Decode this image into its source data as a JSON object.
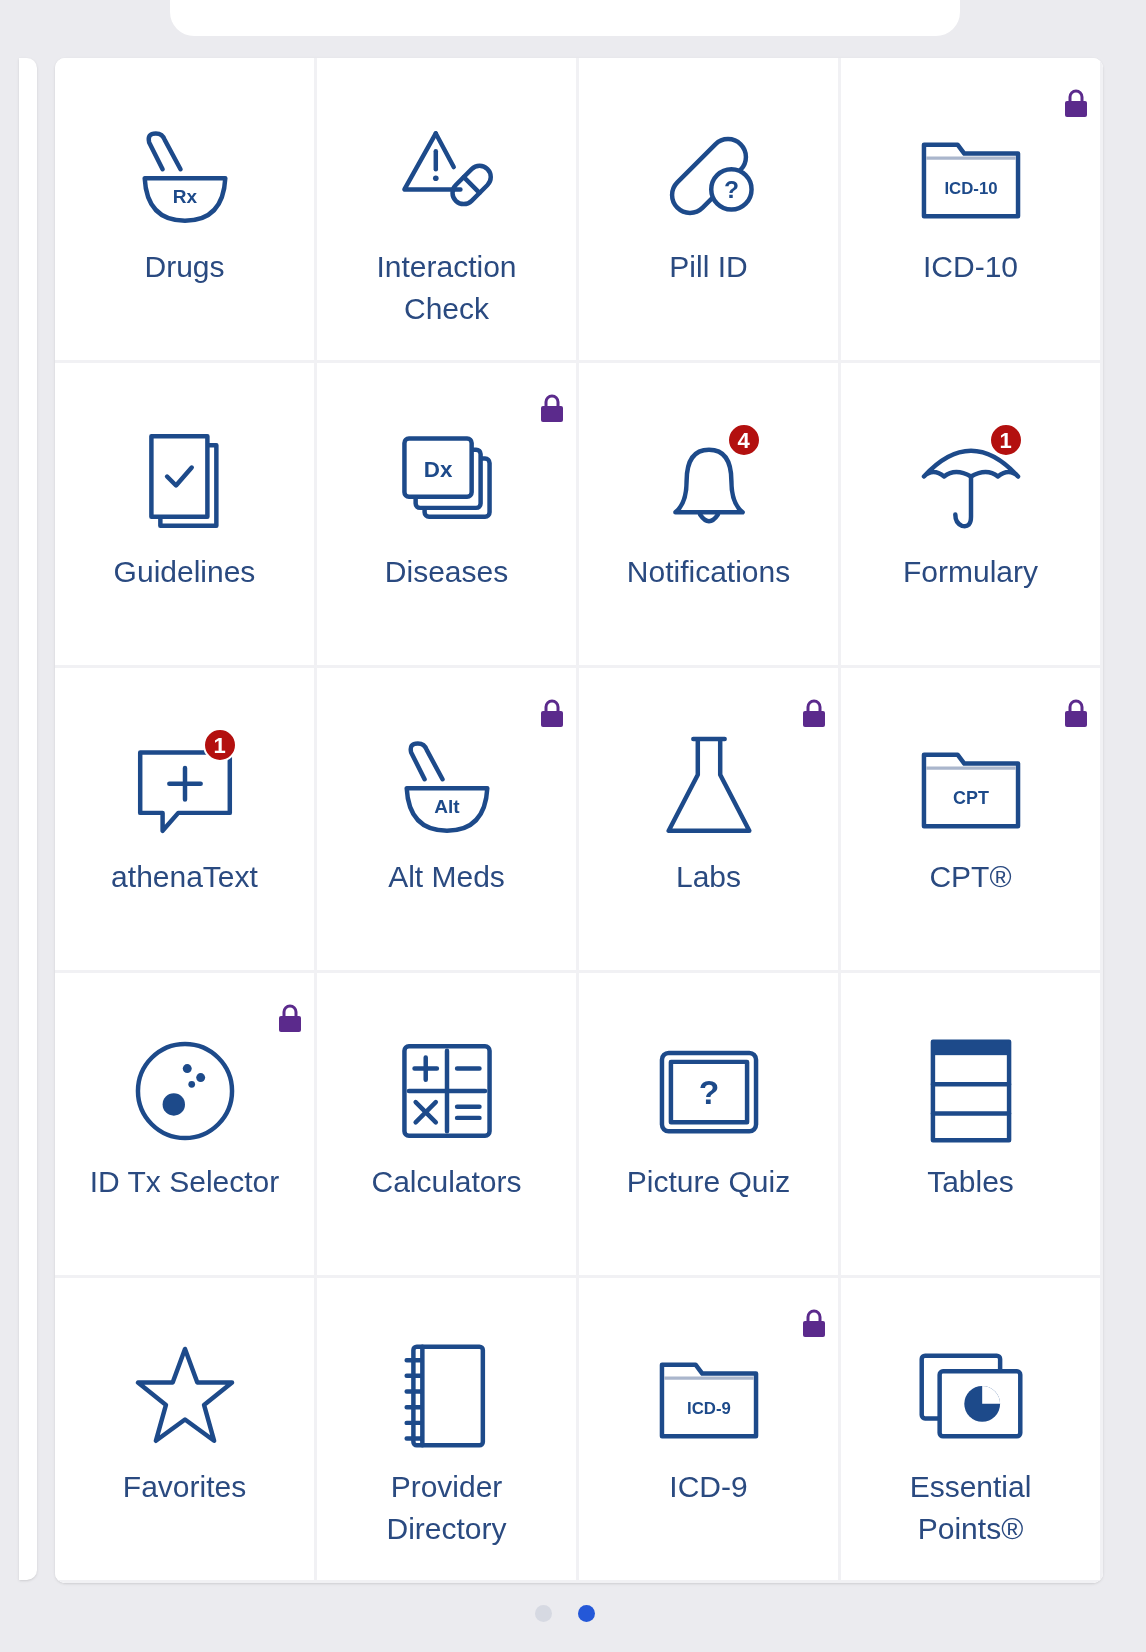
{
  "tiles": [
    {
      "kind": "drugs",
      "icon_text": "Rx",
      "label": "Drugs",
      "locked": false
    },
    {
      "kind": "interaction",
      "label": "Interaction Check",
      "locked": false
    },
    {
      "kind": "pill",
      "icon_text": "?",
      "label": "Pill ID",
      "locked": false
    },
    {
      "kind": "folder",
      "icon_text": "ICD-10",
      "label": "ICD-10",
      "locked": true
    },
    {
      "kind": "guidelines",
      "label": "Guidelines",
      "locked": false
    },
    {
      "kind": "stack",
      "icon_text": "Dx",
      "label": "Diseases",
      "locked": true
    },
    {
      "kind": "bell",
      "label": "Notifications",
      "locked": false,
      "badge": "4"
    },
    {
      "kind": "umbrella",
      "label": "Formulary",
      "locked": false,
      "badge": "1"
    },
    {
      "kind": "chat",
      "label": "athenaText",
      "locked": false,
      "badge": "1"
    },
    {
      "kind": "drugs",
      "icon_text": "Alt",
      "label": "Alt Meds",
      "locked": true
    },
    {
      "kind": "flask",
      "label": "Labs",
      "locked": true
    },
    {
      "kind": "folder",
      "icon_text": "CPT",
      "label": "CPT®",
      "locked": true
    },
    {
      "kind": "dish",
      "label": "ID Tx Selector",
      "locked": true
    },
    {
      "kind": "calculator",
      "label": "Calculators",
      "locked": false
    },
    {
      "kind": "quiz",
      "icon_text": "?",
      "label": "Picture Quiz",
      "locked": false
    },
    {
      "kind": "table",
      "label": "Tables",
      "locked": false
    },
    {
      "kind": "star",
      "label": "Favorites",
      "locked": false
    },
    {
      "kind": "notebook",
      "label": "Provider Directory",
      "locked": false
    },
    {
      "kind": "folder",
      "icon_text": "ICD-9",
      "label": "ICD-9",
      "locked": true
    },
    {
      "kind": "slides",
      "label": "Essential Points®",
      "locked": false
    }
  ],
  "pager": [
    {
      "selected": false
    },
    {
      "selected": true
    }
  ]
}
